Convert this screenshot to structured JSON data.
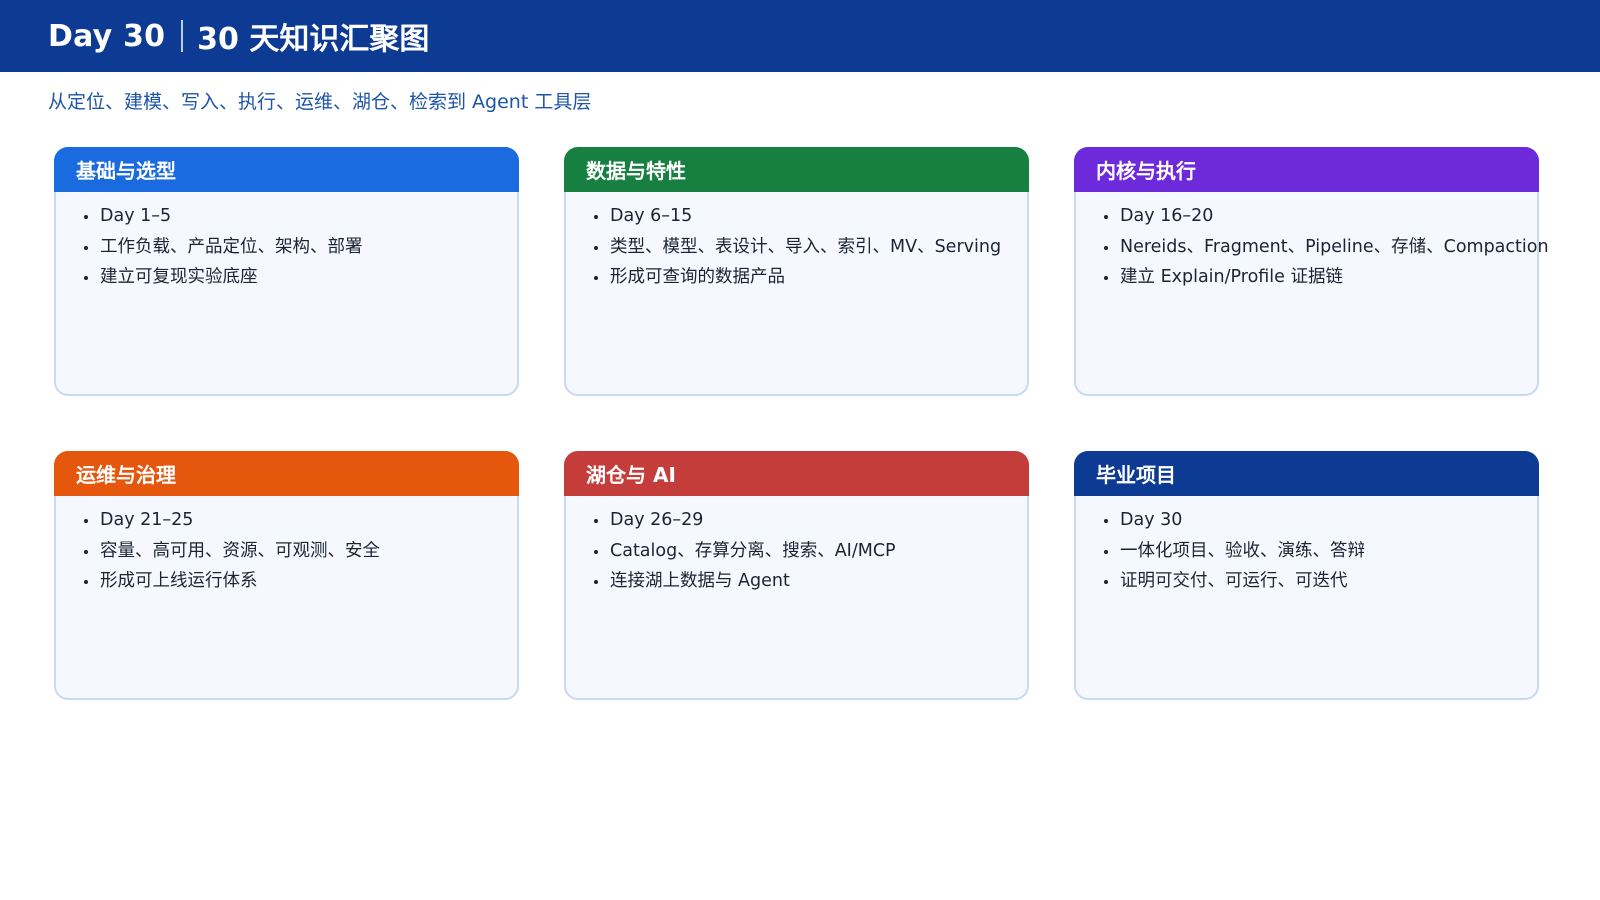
{
  "header": {
    "day": "Day 30",
    "title": "30 天知识汇聚图",
    "background_color": "#0d3b93"
  },
  "subtitle": "从定位、建模、写入、执行、运维、湖仓、检索到 Agent 工具层",
  "cards": [
    {
      "title": "基础与选型",
      "color": "#1a6ae0",
      "items": [
        "Day 1–5",
        "工作负载、产品定位、架构、部署",
        "建立可复现实验底座"
      ]
    },
    {
      "title": "数据与特性",
      "color": "#178040",
      "items": [
        "Day 6–15",
        "类型、模型、表设计、导入、索引、MV、Serving",
        "形成可查询的数据产品"
      ]
    },
    {
      "title": "内核与执行",
      "color": "#6c2ada",
      "items": [
        "Day 16–20",
        "Nereids、Fragment、Pipeline、存储、Compaction",
        "建立 Explain/Profile 证据链"
      ]
    },
    {
      "title": "运维与治理",
      "color": "#e6570e",
      "items": [
        "Day 21–25",
        "容量、高可用、资源、可观测、安全",
        "形成可上线运行体系"
      ]
    },
    {
      "title": "湖仓与 AI",
      "color": "#c53d3a",
      "items": [
        "Day 26–29",
        "Catalog、存算分离、搜索、AI/MCP",
        "连接湖上数据与 Agent"
      ]
    },
    {
      "title": "毕业项目",
      "color": "#0d3b93",
      "items": [
        "Day 30",
        "一体化项目、验收、演练、答辩",
        "证明可交付、可运行、可迭代"
      ]
    }
  ]
}
